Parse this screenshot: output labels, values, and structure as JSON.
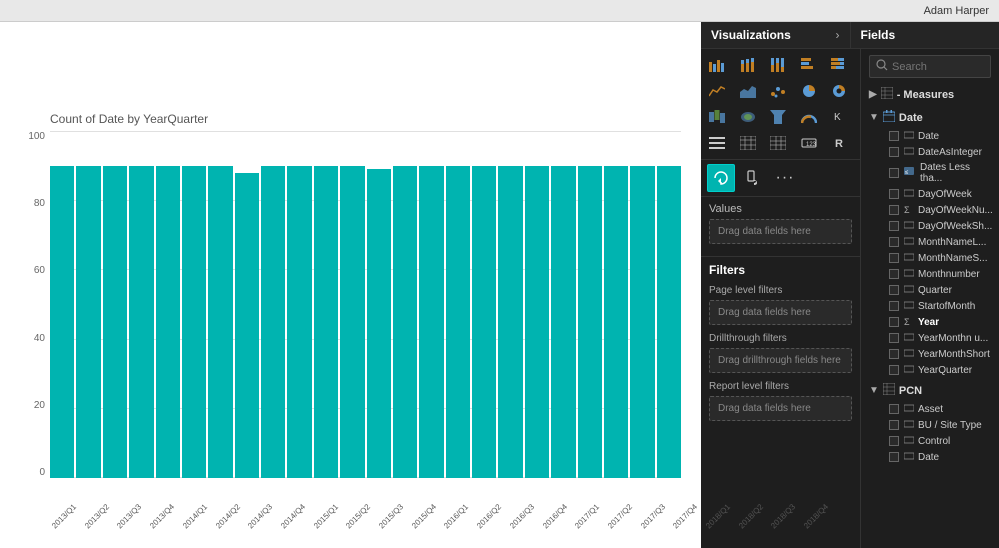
{
  "topbar": {
    "user": "Adam Harper"
  },
  "chart": {
    "title": "Count of Date by YearQuarter",
    "y_labels": [
      "100",
      "80",
      "60",
      "40",
      "20",
      "0"
    ],
    "x_labels": [
      "2013/Q1",
      "2013/Q2",
      "2013/Q3",
      "2013/Q4",
      "2014/Q1",
      "2014/Q2",
      "2014/Q3",
      "2014/Q4",
      "2015/Q1",
      "2015/Q2",
      "2015/Q3",
      "2015/Q4",
      "2016/Q1",
      "2016/Q2",
      "2016/Q3",
      "2016/Q4",
      "2017/Q1",
      "2017/Q2",
      "2017/Q3",
      "2017/Q4",
      "2018/Q1",
      "2018/Q2",
      "2018/Q3",
      "2018/Q4"
    ],
    "bar_heights": [
      90,
      90,
      90,
      90,
      90,
      90,
      90,
      88,
      90,
      90,
      90,
      90,
      89,
      90,
      90,
      90,
      90,
      90,
      90,
      90,
      90,
      90,
      90,
      90
    ],
    "bar_color": "#00b4b0",
    "max_value": 100
  },
  "visualizations": {
    "panel_title": "Visualizations",
    "arrow": "›",
    "values_label": "Values",
    "values_drop": "Drag data fields here",
    "icons": [
      {
        "name": "stacked-bar",
        "symbol": "▬"
      },
      {
        "name": "clustered-bar",
        "symbol": "📊"
      },
      {
        "name": "stacked-bar-h",
        "symbol": "▬"
      },
      {
        "name": "line-chart",
        "symbol": "📈"
      },
      {
        "name": "area-chart",
        "symbol": "◿"
      },
      {
        "name": "scatter",
        "symbol": "⁙"
      },
      {
        "name": "pie",
        "symbol": "◔"
      },
      {
        "name": "donut",
        "symbol": "◎"
      },
      {
        "name": "map",
        "symbol": "🗺"
      },
      {
        "name": "treemap",
        "symbol": "▦"
      },
      {
        "name": "funnel",
        "symbol": "⬡"
      },
      {
        "name": "gauge",
        "symbol": "◑"
      },
      {
        "name": "kpi",
        "symbol": "K"
      },
      {
        "name": "slicer",
        "symbol": "≡"
      },
      {
        "name": "table",
        "symbol": "⊞"
      },
      {
        "name": "matrix",
        "symbol": "⊟"
      },
      {
        "name": "card",
        "symbol": "▭"
      },
      {
        "name": "multirow-card",
        "symbol": "▤"
      },
      {
        "name": "r-visual",
        "symbol": "R"
      },
      {
        "name": "custom",
        "symbol": "⚙"
      }
    ]
  },
  "filters": {
    "panel_title": "Filters",
    "page_level": "Page level filters",
    "drag_page": "Drag data fields here",
    "drillthrough": "Drillthrough filters",
    "drag_drill": "Drag drillthrough fields here",
    "report_level": "Report level filters",
    "drag_report": "Drag data fields here"
  },
  "fields": {
    "panel_title": "Fields",
    "search_placeholder": "Search",
    "groups": [
      {
        "name": "- Measures",
        "icon": "table",
        "expanded": false,
        "items": []
      },
      {
        "name": "Date",
        "icon": "calendar",
        "expanded": true,
        "items": [
          {
            "name": "Date",
            "type": "field",
            "sigma": false
          },
          {
            "name": "DateAsInteger",
            "type": "field",
            "sigma": false
          },
          {
            "name": "Dates Less tha...",
            "type": "field",
            "sigma": false,
            "special": true
          },
          {
            "name": "DayOfWeek",
            "type": "field",
            "sigma": false
          },
          {
            "name": "DayOfWeekNu...",
            "type": "field",
            "sigma": true
          },
          {
            "name": "DayOfWeekSh...",
            "type": "field",
            "sigma": false
          },
          {
            "name": "MonthNameL...",
            "type": "field",
            "sigma": false
          },
          {
            "name": "MonthNameS...",
            "type": "field",
            "sigma": false
          },
          {
            "name": "Monthnumber",
            "type": "field",
            "sigma": false
          },
          {
            "name": "Quarter",
            "type": "field",
            "sigma": false
          },
          {
            "name": "StartofMonth",
            "type": "field",
            "sigma": false
          },
          {
            "name": "Year",
            "type": "field",
            "sigma": true,
            "highlighted": true
          },
          {
            "name": "YearMonthn u...",
            "type": "field",
            "sigma": false
          },
          {
            "name": "YearMonthShort",
            "type": "field",
            "sigma": false
          },
          {
            "name": "YearQuarter",
            "type": "field",
            "sigma": false
          }
        ]
      },
      {
        "name": "PCN",
        "icon": "table",
        "expanded": true,
        "items": [
          {
            "name": "Asset",
            "type": "field",
            "sigma": false
          },
          {
            "name": "BU / Site Type",
            "type": "field",
            "sigma": false
          },
          {
            "name": "Control",
            "type": "field",
            "sigma": false
          },
          {
            "name": "Date",
            "type": "field",
            "sigma": false
          }
        ]
      }
    ]
  }
}
